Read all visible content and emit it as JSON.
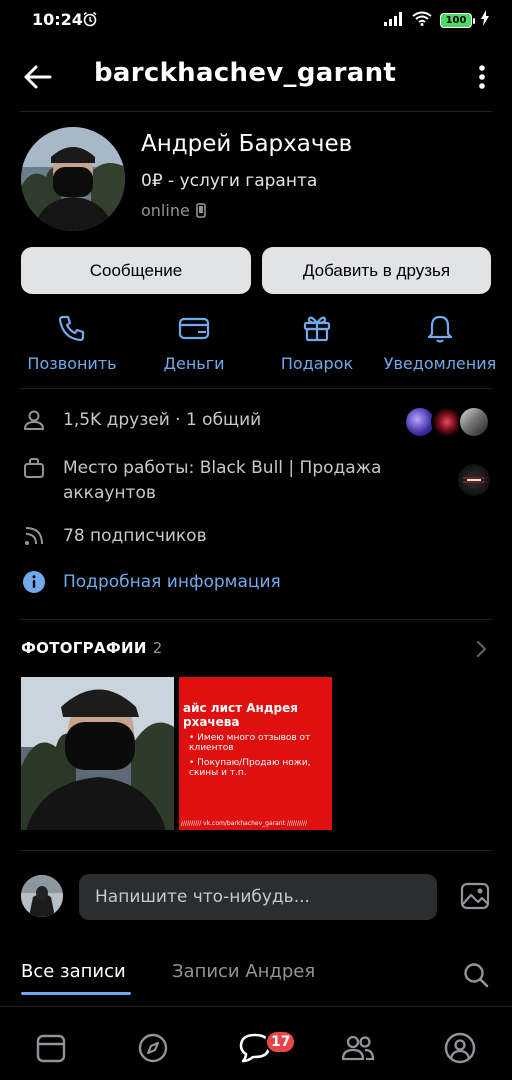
{
  "status_bar": {
    "time": "10:24",
    "battery": "100"
  },
  "header": {
    "username": "barckhachev_garant"
  },
  "profile": {
    "name": "Андрей Бархачев",
    "status": "0₽ - услуги гаранта",
    "online": "online"
  },
  "buttons": {
    "message": "Сообщение",
    "add_friend": "Добавить в друзья"
  },
  "actions": [
    {
      "label": "Позвонить",
      "icon": "phone-icon"
    },
    {
      "label": "Деньги",
      "icon": "money-icon"
    },
    {
      "label": "Подарок",
      "icon": "gift-icon"
    },
    {
      "label": "Уведомления",
      "icon": "bell-icon"
    }
  ],
  "info": {
    "friends": "1,5K друзей · 1 общий",
    "work": "Место работы: Black Bull | Продажа аккаунтов",
    "followers": "78 подписчиков",
    "details": "Подробная информация"
  },
  "photos": {
    "title": "ФОТОГРАФИИ",
    "count": "2",
    "card": {
      "title": "айс лист Андрея рхачева",
      "items": [
        "• Имею много отзывов от клиентов",
        "• Покупаю/Продаю ножи, скины и т.п."
      ],
      "footer": "////////// vk.com/barkhachev_garant //////////"
    }
  },
  "composer": {
    "placeholder": "Напишите что-нибудь..."
  },
  "tabs": {
    "all": "Все записи",
    "andrey": "Записи Андрея"
  },
  "nav": {
    "messages_badge": "17"
  },
  "colors": {
    "accent": "#71aaeb",
    "badge": "#e64646",
    "button_bg": "#e1e3e6"
  }
}
